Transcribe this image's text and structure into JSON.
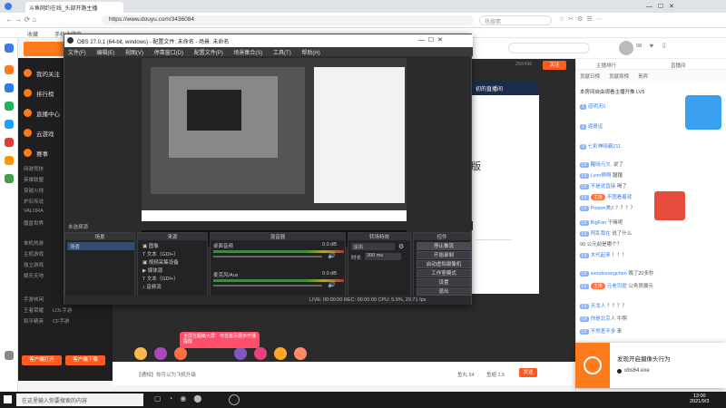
{
  "browser": {
    "tab_title": "斗鱼网约在线_头部开路主播",
    "url": "https://www.douyu.com/3436084",
    "search_placeholder": "热搜素 ",
    "bookmarks": [
      "收藏",
      "手机收藏夹"
    ],
    "addr_right": "热搜 "
  },
  "douyu": {
    "sidebar": [
      {
        "label": "我的关注"
      },
      {
        "label": "排行榜"
      },
      {
        "label": "直播中心"
      },
      {
        "label": "云游戏"
      },
      {
        "label": "赛事"
      }
    ],
    "small_labels": [
      "网游竞技",
      "英雄联盟",
      "穿越火线",
      "炉石传说",
      "VALORA",
      "魔兽世界",
      "单机热游",
      "主机游戏",
      "独立游戏",
      "娱乐天地",
      "手游休闲",
      "王者荣耀",
      "LOL手游",
      "和平精英",
      "CF手游"
    ],
    "sidebar_buttons": [
      "客户端打开",
      "客户端下载"
    ],
    "header_tabs": [
      "主播排行",
      "直播间",
      "贡献日榜",
      "贡献周榜",
      "贵宾"
    ],
    "follow_count": "256496",
    "follow_label": "关注",
    "right_tag": "剁开",
    "video_title": "初的直播间",
    "video_sub": "版"
  },
  "chat": {
    "notice": "本房间自由观看主播开推 LV5",
    "top_users": [
      "道明天0",
      "逼哥远",
      "七彩神晓霸211"
    ],
    "messages": [
      {
        "name": "醒晓元欠.",
        "text": "说了"
      },
      {
        "name": "Lynn啊啊",
        "text": "蹭蹭"
      },
      {
        "name": "不是说直接",
        "text": "喝了"
      },
      {
        "name": "不图看着就",
        "text": ""
      },
      {
        "name": "Poison美Z",
        "text": "？？？？"
      },
      {
        "name": "BigFan",
        "text": "干嘛呢"
      },
      {
        "name": "阿乱我在",
        "text": "说了什么"
      },
      {
        "name": "90 公元前是哪个",
        "text": "？"
      },
      {
        "name": "木代起来",
        "text": "！！！"
      },
      {
        "name": "woodseangchen",
        "text": "晚了20多秒"
      },
      {
        "name": "元老司提",
        "text": "公务员展示"
      },
      {
        "name": "天龙人",
        "text": "？？？？"
      },
      {
        "name": "你是北京人",
        "text": "牛啊"
      },
      {
        "name": "不然差不多",
        "text": "来"
      }
    ],
    "badge_text": "主播",
    "input_placeholder": "说点什么吧"
  },
  "obs": {
    "title": "OBS 27.0.1 (64-bit, windows) - 配置文件: 未命名 - 场景: 未命名",
    "menu": [
      "文件(F)",
      "编辑(E)",
      "视图(V)",
      "停靠窗口(D)",
      "配置文件(P)",
      "场景集合(S)",
      "工具(T)",
      "帮助(H)"
    ],
    "scene_label": "未选择源",
    "dock_scenes_title": "场景",
    "scenes": [
      "场景"
    ],
    "dock_sources_title": "来源",
    "sources": [
      "图像",
      "文本（GDI+）",
      "视频采集设备",
      "媒体源",
      "文本（GDI+）",
      "音频流"
    ],
    "dock_mixer_title": "混音器",
    "mixer": [
      {
        "name": "桌面音频",
        "db": "0.0 dB"
      },
      {
        "name": "麦克风/Aux",
        "db": "0.0 dB"
      }
    ],
    "dock_trans_title": "转场特效",
    "trans": {
      "type": "淡出",
      "duration_label": "时长",
      "duration": "300 ms"
    },
    "dock_controls_title": "控件",
    "controls": [
      "停止推流",
      "开始录制",
      "启动虚拟摄像机",
      "工作室模式",
      "设置",
      "退出"
    ],
    "status": "LIVE: 00:00:00   REC: 00:00:00   CPU: 5.9%, 29.71 fps"
  },
  "promo": {
    "text": "全屏在超级大屏：可在首页展示开播提醒"
  },
  "bottom_bar": {
    "text": "【通知】你可以为飞机升级",
    "counts": [
      "鱼丸 54",
      "鱼翅 1.5"
    ],
    "send": "发送"
  },
  "toast": {
    "title": "发现开启摄像头行为",
    "sub": "obs64.exe"
  },
  "taskbar": {
    "search_placeholder": "在这里输入你要搜索的内容",
    "time": "13:00",
    "date": "2021/9/3"
  },
  "colors": {
    "accent": "#ff7a1a",
    "obs_bg": "#2b2b2e",
    "chat_badge": "#ff6f3c",
    "promo": "#ff4e6a"
  }
}
